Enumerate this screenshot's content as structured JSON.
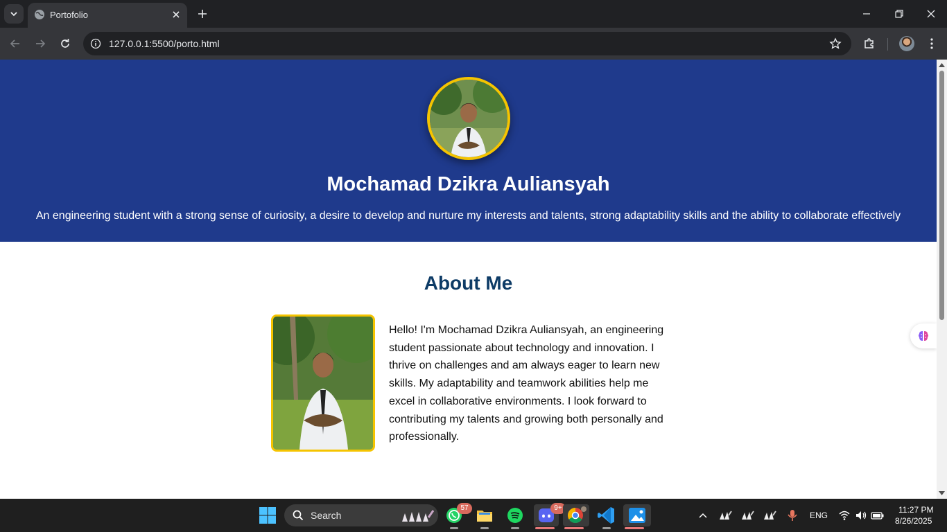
{
  "browser": {
    "tab_title": "Portofolio",
    "url": "127.0.0.1:5500/porto.html"
  },
  "hero": {
    "name": "Mochamad Dzikra Auliansyah",
    "tagline": "An engineering student with a strong sense of curiosity, a desire to develop and nurture my interests and talents, strong adaptability skills and the ability to collaborate effectively"
  },
  "about": {
    "title": "About Me",
    "text": "Hello! I'm Mochamad Dzikra Auliansyah, an engineering student passionate about technology and innovation. I thrive on challenges and am always eager to learn new skills. My adaptability and teamwork abilities help me excel in collaborative environments. I look forward to contributing my talents and growing both personally and professionally."
  },
  "taskbar": {
    "search_label": "Search",
    "whatsapp_badge": "57",
    "discord_badge": "9+",
    "language": "ENG",
    "time": "11:27 PM",
    "date": "8/26/2025"
  },
  "colors": {
    "hero_bg": "#1f3a8c",
    "accent_gold": "#f5c400",
    "heading_blue": "#0d3b66"
  }
}
